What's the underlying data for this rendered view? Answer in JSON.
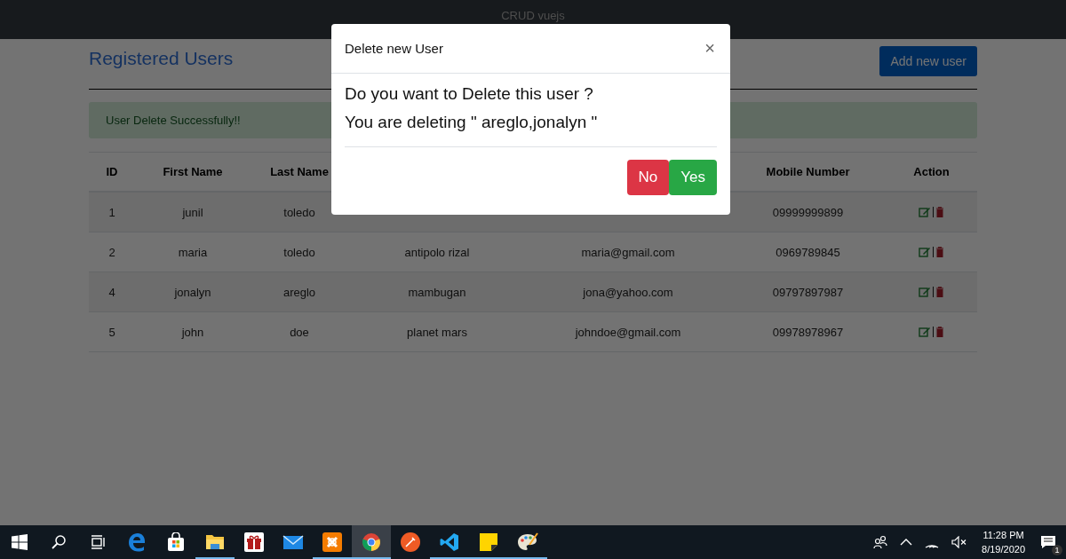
{
  "navbar": {
    "title": "CRUD vuejs"
  },
  "page": {
    "heading": "Registered Users",
    "add_button": "Add new user",
    "alert": "User Delete Successfully!!"
  },
  "table": {
    "columns": [
      "ID",
      "First Name",
      "Last Name",
      "",
      "",
      "Mobile Number",
      "Action"
    ],
    "rows": [
      {
        "cells": [
          "1",
          "junil",
          "toledo",
          "",
          "",
          "09999999899"
        ]
      },
      {
        "cells": [
          "2",
          "maria",
          "toledo",
          "antipolo rizal",
          "maria@gmail.com",
          "0969789845"
        ]
      },
      {
        "cells": [
          "4",
          "jonalyn",
          "areglo",
          "mambugan",
          "jona@yahoo.com",
          "09797897987"
        ]
      },
      {
        "cells": [
          "5",
          "john",
          "doe",
          "planet mars",
          "johndoe@gmail.com",
          "09978978967"
        ]
      }
    ]
  },
  "modal": {
    "title": "Delete new User",
    "close": "×",
    "question": "Do you want to Delete this user ?",
    "detail": "You are deleting \" areglo,jonalyn \"",
    "buttons": [
      {
        "label": "No",
        "kind": "danger"
      },
      {
        "label": "Yes",
        "kind": "success"
      }
    ]
  },
  "taskbar": {
    "apps": [
      {
        "kind": "start",
        "selected": false,
        "running": false
      },
      {
        "kind": "search",
        "selected": false,
        "running": false
      },
      {
        "kind": "taskview",
        "selected": false,
        "running": false
      },
      {
        "kind": "edge",
        "selected": false,
        "running": false
      },
      {
        "kind": "store",
        "selected": false,
        "running": false
      },
      {
        "kind": "explorer",
        "selected": false,
        "running": true
      },
      {
        "kind": "gift",
        "selected": false,
        "running": false
      },
      {
        "kind": "mail",
        "selected": false,
        "running": false
      },
      {
        "kind": "xampp",
        "selected": false,
        "running": true
      },
      {
        "kind": "chrome",
        "selected": true,
        "running": true
      },
      {
        "kind": "postman",
        "selected": false,
        "running": false
      },
      {
        "kind": "vscode",
        "selected": false,
        "running": true
      },
      {
        "kind": "sticky",
        "selected": false,
        "running": true
      },
      {
        "kind": "paint",
        "selected": false,
        "running": true
      }
    ],
    "time": "11:28 PM",
    "date": "8/19/2020",
    "notifications": "1"
  }
}
